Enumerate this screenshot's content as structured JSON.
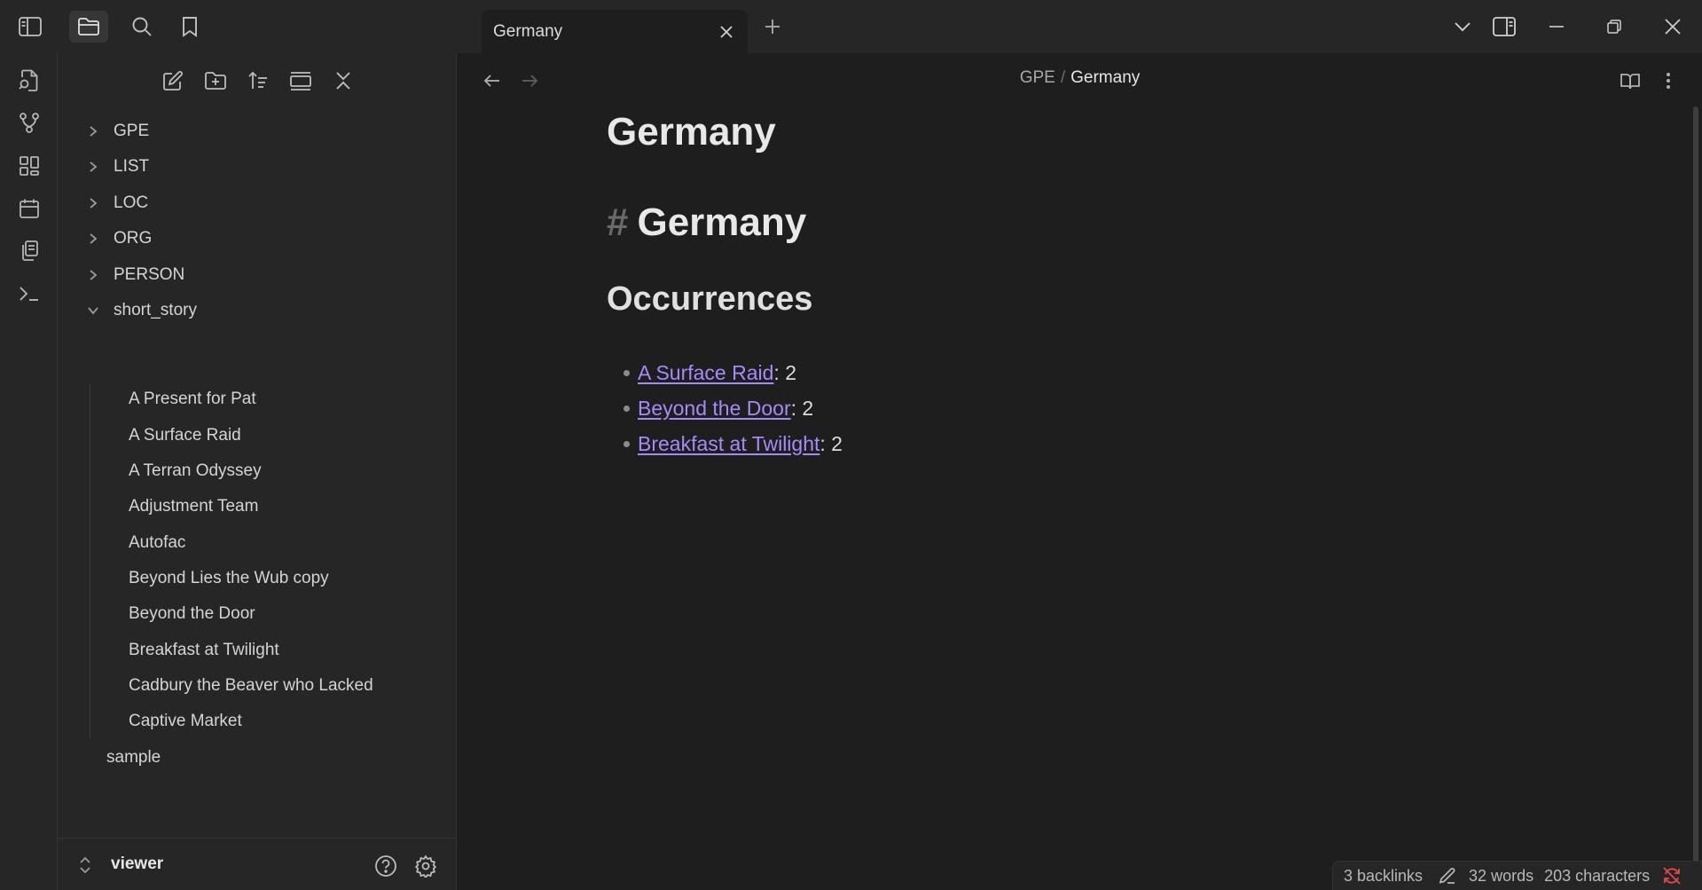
{
  "titlebar": {
    "tab_title": "Germany"
  },
  "breadcrumb": {
    "parent": "GPE",
    "separator": "/",
    "current": "Germany"
  },
  "file_tree": {
    "folders": [
      {
        "label": "GPE",
        "expanded": false
      },
      {
        "label": "LIST",
        "expanded": false
      },
      {
        "label": "LOC",
        "expanded": false
      },
      {
        "label": "ORG",
        "expanded": false
      },
      {
        "label": "PERSON",
        "expanded": false
      },
      {
        "label": "short_story",
        "expanded": true
      }
    ],
    "short_story_files": [
      "A Present for Pat",
      "A Surface Raid",
      "A Terran Odyssey",
      "Adjustment Team",
      "Autofac",
      "Beyond Lies the Wub copy",
      "Beyond the Door",
      "Breakfast at Twilight",
      "Cadbury the Beaver who Lacked",
      "Captive Market"
    ],
    "root_files": [
      "sample"
    ]
  },
  "vault": {
    "name": "viewer"
  },
  "note": {
    "inline_title": "Germany",
    "heading_marker": "#",
    "heading1": "Germany",
    "heading2": "Occurrences",
    "occurrences": [
      {
        "link": "A Surface Raid",
        "count": ": 2"
      },
      {
        "link": "Beyond the Door",
        "count": ": 2"
      },
      {
        "link": "Breakfast at Twilight",
        "count": ": 2"
      }
    ]
  },
  "statusbar": {
    "backlinks": "3 backlinks",
    "words": "32 words",
    "characters": "203 characters"
  },
  "colors": {
    "background": "#1e1e1e",
    "sidebar": "#262626",
    "link": "#a68af9",
    "sync_error": "#e5484d"
  },
  "icons": {
    "titlebar": [
      "sidebar-toggle-icon",
      "folder-icon",
      "search-icon",
      "bookmark-icon",
      "close-icon",
      "plus-icon",
      "chevron-down-icon",
      "right-sidebar-icon",
      "minimize-icon",
      "restore-icon",
      "window-close-icon"
    ],
    "ribbon": [
      "quick-switch-icon",
      "graph-icon",
      "canvas-icon",
      "calendar-icon",
      "templates-icon",
      "terminal-icon"
    ],
    "file_nav": [
      "new-note-icon",
      "new-folder-icon",
      "sort-icon",
      "collapse-view-icon",
      "collapse-all-icon"
    ],
    "view": [
      "back-arrow-icon",
      "forward-arrow-icon",
      "reading-view-icon",
      "more-options-icon"
    ],
    "status": [
      "pencil-icon",
      "sync-error-icon"
    ]
  }
}
